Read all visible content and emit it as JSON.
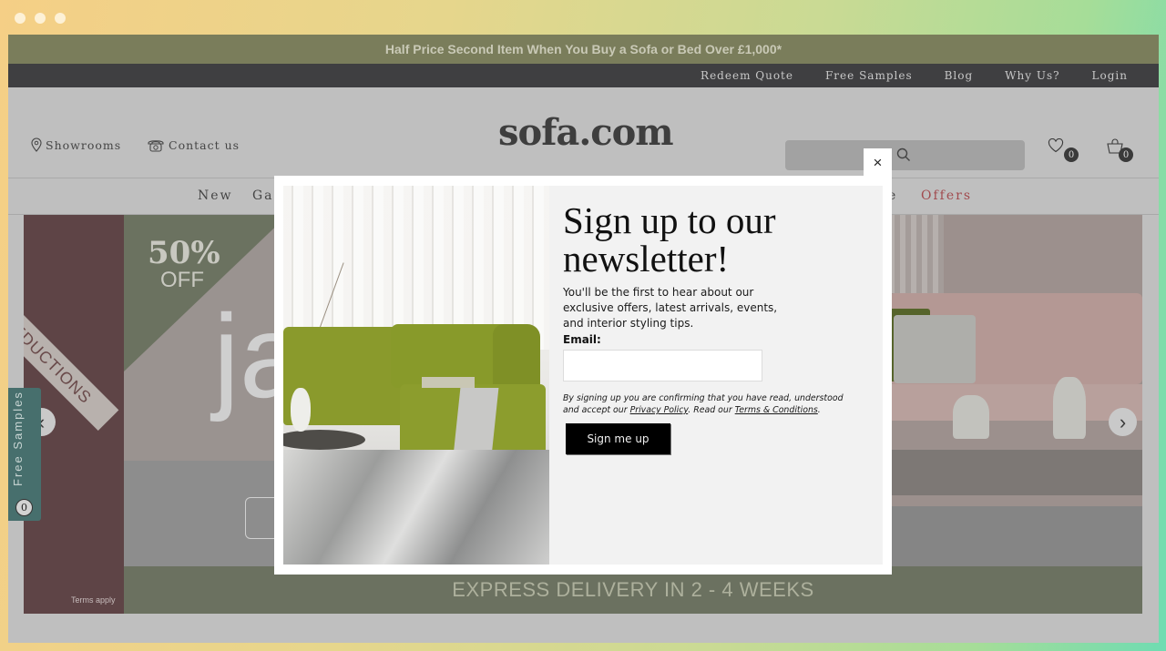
{
  "window": {
    "traffic_lights": [
      "close",
      "minimize",
      "maximize"
    ]
  },
  "promo_bar": {
    "text": "Half Price Second Item When You Buy a Sofa or Bed Over £1,000*"
  },
  "utility_nav": {
    "items": [
      {
        "label": "Redeem Quote"
      },
      {
        "label": "Free Samples"
      },
      {
        "label": "Blog"
      },
      {
        "label": "Why Us?"
      },
      {
        "label": "Login"
      }
    ]
  },
  "header": {
    "showrooms_label": "Showrooms",
    "showrooms_icon": "map-pin-icon",
    "contact_label": "Contact us",
    "contact_icon": "phone-icon",
    "logo": "sofa.com",
    "search": {
      "placeholder": "",
      "value": "",
      "icon": "search-icon"
    },
    "wishlist": {
      "icon": "heart-icon",
      "count": "0"
    },
    "basket": {
      "icon": "basket-icon",
      "count": "0"
    }
  },
  "main_nav": {
    "items": [
      {
        "label": "New"
      },
      {
        "label": "Ga"
      },
      {
        "label": "e"
      },
      {
        "label": "Offers",
        "highlight": true
      }
    ],
    "accent_color": "#a14a4e"
  },
  "hero": {
    "reductions_label": "REDUCTIONS",
    "discount_value": "50%",
    "discount_label": "OFF",
    "brand_partial": "ja",
    "terms_label": "Terms apply",
    "express_banner": "EXPRESS DELIVERY IN 2 - 4 WEEKS",
    "prev_arrow": "‹",
    "next_arrow": "›"
  },
  "free_samples_tab": {
    "label": "Free Samples",
    "count": "0",
    "color": "#476f6d"
  },
  "newsletter_modal": {
    "close_label": "×",
    "title": "Sign up to our newsletter!",
    "description": "You'll be the first to hear about our exclusive offers, latest arrivals, events, and interior styling tips.",
    "email_label": "Email:",
    "email_value": "",
    "email_placeholder": "",
    "consent_prefix": "By signing up you are confirming that you have read, understood and accept our ",
    "privacy_link": "Privacy Policy",
    "consent_middle": ". Read our ",
    "terms_link": "Terms & Conditions",
    "consent_suffix": ".",
    "submit_label": "Sign me up"
  }
}
